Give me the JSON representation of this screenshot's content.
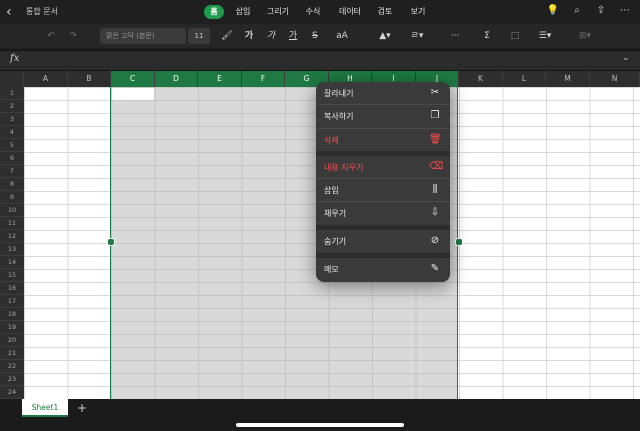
{
  "app": {
    "doc_title": "통합 문서"
  },
  "ribbon": {
    "tabs": [
      {
        "label": "홈",
        "active": true
      },
      {
        "label": "삽입"
      },
      {
        "label": "그리기"
      },
      {
        "label": "수식"
      },
      {
        "label": "데이터"
      },
      {
        "label": "검토"
      },
      {
        "label": "보기"
      }
    ]
  },
  "toolbar": {
    "font_name": "맑은 고딕 (본문)",
    "font_size": "11",
    "bold": "가",
    "italic": "가",
    "underline": "가",
    "strike": "S",
    "font_size_ctrl": "aA",
    "align": "三",
    "more": "···",
    "sum": "Σ"
  },
  "formula": {
    "fx": "fx"
  },
  "grid": {
    "columns": [
      "A",
      "B",
      "C",
      "D",
      "E",
      "F",
      "G",
      "H",
      "I",
      "J",
      "K",
      "L",
      "M",
      "N"
    ],
    "selected_columns": [
      "C",
      "D",
      "E",
      "F",
      "G",
      "H",
      "I",
      "J"
    ],
    "rows": [
      "1",
      "2",
      "3",
      "4",
      "5",
      "6",
      "7",
      "8",
      "9",
      "10",
      "11",
      "12",
      "13",
      "14",
      "15",
      "16",
      "17",
      "18",
      "19",
      "20",
      "21",
      "22",
      "23",
      "24"
    ]
  },
  "context_menu": {
    "items": [
      {
        "label": "잘라내기",
        "icon": "scissors-icon",
        "glyph": "✂"
      },
      {
        "label": "복사하기",
        "icon": "copy-icon",
        "glyph": "❐"
      },
      {
        "label": "삭제",
        "icon": "trash-icon",
        "glyph": "🗑",
        "destructive": true
      },
      {
        "label": "내용 지우기",
        "icon": "eraser-icon",
        "glyph": "⌫",
        "destructive": true
      },
      {
        "label": "삽입",
        "icon": "insert-column-icon",
        "glyph": "⫼"
      },
      {
        "label": "채우기",
        "icon": "fill-down-icon",
        "glyph": "⇩"
      },
      {
        "label": "숨기기",
        "icon": "hide-eye-icon",
        "glyph": "⊘"
      },
      {
        "label": "메모",
        "icon": "comment-icon",
        "glyph": "✎"
      }
    ]
  },
  "sheets": {
    "tabs": [
      "Sheet1"
    ],
    "add": "+"
  },
  "colors": {
    "accent": "#1e7a42",
    "tab_active": "#1e9c4b",
    "destructive": "#ff4d4d"
  }
}
